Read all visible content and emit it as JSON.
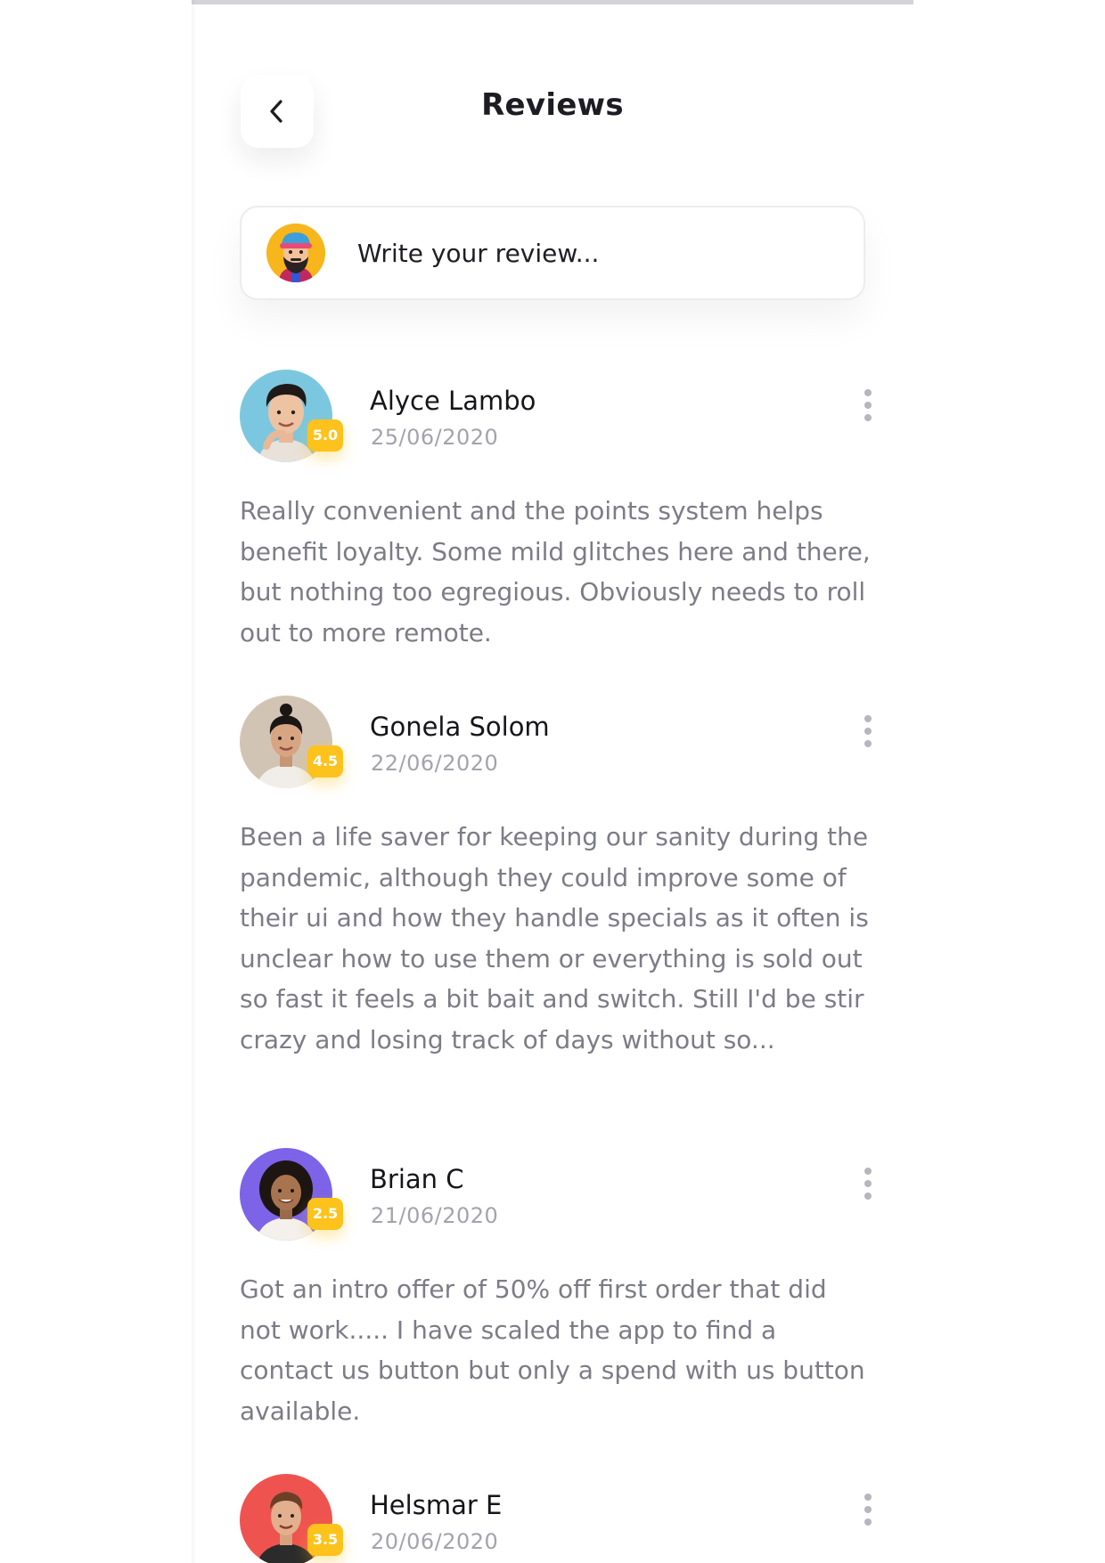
{
  "header": {
    "title": "Reviews",
    "back_icon": "chevron-left-icon"
  },
  "composer": {
    "placeholder": "Write your review..."
  },
  "colors": {
    "rating_badge": "#fdc21b",
    "name": "#15151a",
    "date": "#a3a3ad",
    "body_text": "#7c7c86"
  },
  "reviews": [
    {
      "name": "Alyce Lambo",
      "date": "25/06/2020",
      "rating": "5.0",
      "text": "Really convenient and the points system helps benefit loyalty. Some mild glitches here and there, but nothing too egregious. Obviously needs to roll out to more remote."
    },
    {
      "name": "Gonela Solom",
      "date": "22/06/2020",
      "rating": "4.5",
      "text": "Been a life saver for keeping our sanity during the pandemic, although they could improve some of their ui and how they handle specials as it often is unclear how to use them or everything is sold out so fast it feels a bit bait and switch. Still I'd be stir crazy and losing track of days without so..."
    },
    {
      "name": "Brian C",
      "date": "21/06/2020",
      "rating": "2.5",
      "text": "Got an intro offer of 50% off first order that did not work..... I have scaled the app to find a contact us button but only a spend with us button available."
    },
    {
      "name": "Helsmar E",
      "date": "20/06/2020",
      "rating": "3.5",
      "text": ""
    }
  ]
}
